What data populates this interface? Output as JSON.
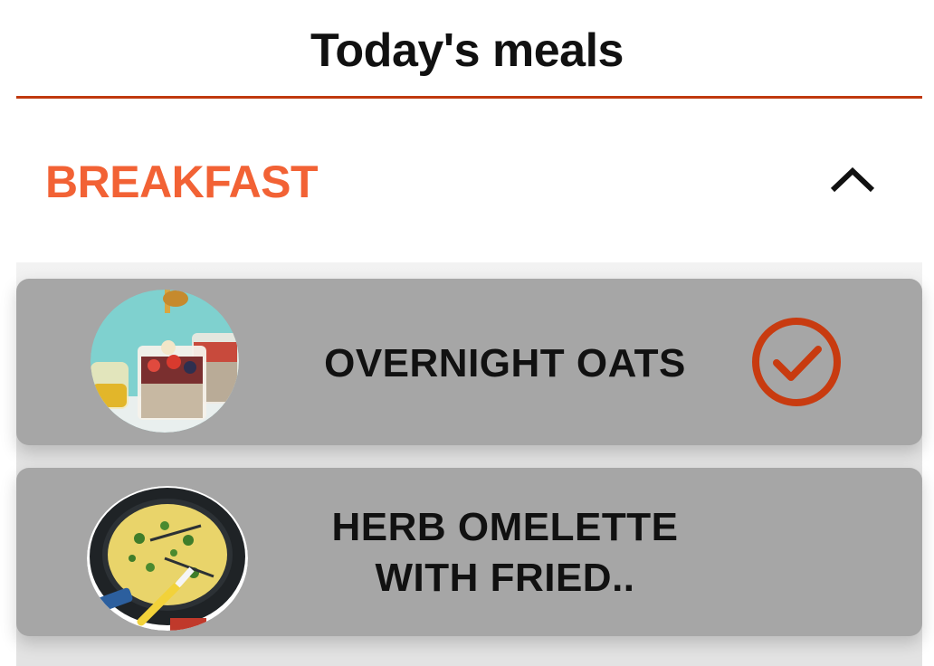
{
  "header": {
    "title": "Today's meals"
  },
  "section": {
    "title": "BREAKFAST",
    "toggle_icon": "chevron-up-icon"
  },
  "meals": [
    {
      "name_line1": "OVERNIGHT OATS",
      "name_line2": "",
      "image": "overnight-oats-photo",
      "status_icon": "check-circle-icon",
      "completed": true
    },
    {
      "name_line1": "HERB OMELETTE",
      "name_line2": "WITH FRIED..",
      "image": "herb-omelette-photo",
      "completed": false
    }
  ],
  "colors": {
    "accent": "#c0390f",
    "section_title": "#f26235",
    "card_bg": "#a6a6a6",
    "check": "#c83b10"
  }
}
